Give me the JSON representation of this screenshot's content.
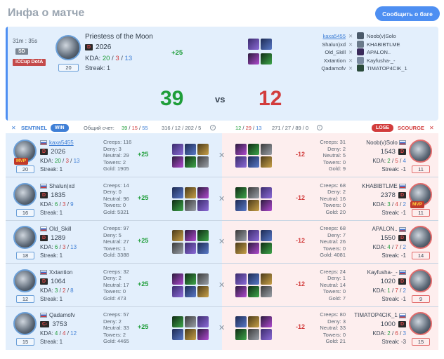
{
  "page": {
    "title": "Инфа о матче",
    "bug_button": "Сообщить о баге"
  },
  "colors": {
    "accent": "#4e8ff2",
    "win": "#1f9e3a",
    "lose": "#d23c3c",
    "sentinel_bg": "#e3effc",
    "scourge_bg": "#fdeeee"
  },
  "summary": {
    "duration": "31m : 35s",
    "mode": "SD",
    "league": "iCCup DotA",
    "hero": "Priestess of the Moon",
    "rating": "2026",
    "kda_label": "KDA:",
    "kills": "20",
    "deaths": "3",
    "assists": "13",
    "streak": "Streak: 1",
    "level": "20",
    "delta": "+25",
    "score_sentinel": "39",
    "vs": "vs",
    "score_scourge": "12",
    "sentinel_names": [
      "kaxa5455",
      "Shalun)xd",
      "Old_Skill",
      "Xxtantion",
      "Qadamofv"
    ],
    "scourge_names": [
      "Noob(v)Solo",
      "KHABIBTLME",
      "APALON..",
      "Kayfusha-_-",
      "TIMATOP4CIK_1"
    ]
  },
  "teams": {
    "sentinel_label": "SENTINEL",
    "win_label": "WIN",
    "total_label": "Общий счет:",
    "sentinel_kda": [
      "39",
      "15",
      "55"
    ],
    "sentinel_extra": "316 / 12 / 202 / 5",
    "scourge_kda": [
      "12",
      "29",
      "13"
    ],
    "scourge_extra": "271 / 27 / 89 / 0",
    "lose_label": "LOSE",
    "scourge_label": "SCOURGE"
  },
  "sentinel": [
    {
      "name": "kaxa5455",
      "rating": "2026",
      "rank": "D",
      "k": "20",
      "d": "3",
      "a": "13",
      "streak": "Streak: 1",
      "level": "20",
      "mvp": "MVP",
      "creeps": "Creeps: 116",
      "deny": "Deny: 3",
      "neutral": "Neutral: 29",
      "towers": "Towers: 2",
      "gold": "Gold: 1905",
      "delta": "+25"
    },
    {
      "name": "Shalun)xd",
      "rating": "1835",
      "rank": "D",
      "k": "6",
      "d": "3",
      "a": "9",
      "streak": "Streak: 1",
      "level": "16",
      "mvp": "",
      "creeps": "Creeps: 14",
      "deny": "Deny: 0",
      "neutral": "Neutral: 96",
      "towers": "Towers: 0",
      "gold": "Gold: 5321",
      "delta": "+25"
    },
    {
      "name": "Old_Skill",
      "rating": "1289",
      "rank": "D",
      "k": "6",
      "d": "3",
      "a": "13",
      "streak": "Streak: 1",
      "level": "18",
      "mvp": "",
      "creeps": "Creeps: 97",
      "deny": "Deny: 5",
      "neutral": "Neutral: 27",
      "towers": "Towers: 1",
      "gold": "Gold: 3388",
      "delta": "+25"
    },
    {
      "name": "Xxtantion",
      "rating": "1064",
      "rank": "D",
      "k": "3",
      "d": "2",
      "a": "8",
      "streak": "Streak: 1",
      "level": "12",
      "mvp": "",
      "creeps": "Creeps: 32",
      "deny": "Deny: 2",
      "neutral": "Neutral: 17",
      "towers": "Towers: 0",
      "gold": "Gold: 473",
      "delta": "+25"
    },
    {
      "name": "Qadamofv",
      "rating": "3753",
      "rank": "C-",
      "k": "4",
      "d": "4",
      "a": "12",
      "streak": "Streak: 1",
      "level": "15",
      "mvp": "",
      "creeps": "Creeps: 57",
      "deny": "Deny: 2",
      "neutral": "Neutral: 33",
      "towers": "Towers: 2",
      "gold": "Gold: 4465",
      "delta": "+25"
    }
  ],
  "scourge": [
    {
      "name": "Noob(v)Solo",
      "rating": "1543",
      "rank": "D",
      "k": "2",
      "d": "5",
      "a": "4",
      "streak": "Streak: -1",
      "level": "11",
      "mvp": "",
      "creeps": "Creeps: 31",
      "deny": "Deny: 2",
      "neutral": "Neutral: 5",
      "towers": "Towers: 0",
      "gold": "Gold: 9",
      "delta": "-12"
    },
    {
      "name": "KHABIBTLME",
      "rating": "2378",
      "rank": "D",
      "k": "3",
      "d": "4",
      "a": "2",
      "streak": "Streak: -1",
      "level": "11",
      "mvp": "MVP",
      "creeps": "Creeps: 68",
      "deny": "Deny: 2",
      "neutral": "Neutral: 16",
      "towers": "Towers: 0",
      "gold": "Gold: 20",
      "delta": "-12"
    },
    {
      "name": "APALON..",
      "rating": "1550",
      "rank": "D",
      "k": "4",
      "d": "7",
      "a": "2",
      "streak": "Streak: -1",
      "level": "14",
      "mvp": "",
      "creeps": "Creeps: 68",
      "deny": "Deny: 7",
      "neutral": "Neutral: 26",
      "towers": "Towers: 0",
      "gold": "Gold: 4081",
      "delta": "-12"
    },
    {
      "name": "Kayfusha-_-",
      "rating": "1020",
      "rank": "D",
      "k": "1",
      "d": "7",
      "a": "2",
      "streak": "Streak: -1",
      "level": "9",
      "mvp": "",
      "creeps": "Creeps: 24",
      "deny": "Deny: 1",
      "neutral": "Neutral: 14",
      "towers": "Towers: 0",
      "gold": "Gold: 7",
      "delta": "-12"
    },
    {
      "name": "TIMATOP4CIK_1",
      "rating": "1000",
      "rank": "D",
      "k": "2",
      "d": "6",
      "a": "3",
      "streak": "Streak: -3",
      "level": "15",
      "mvp": "",
      "creeps": "Creeps: 80",
      "deny": "Deny: 3",
      "neutral": "Neutral: 33",
      "towers": "Towers: 0",
      "gold": "Gold: 21",
      "delta": "-12"
    }
  ]
}
